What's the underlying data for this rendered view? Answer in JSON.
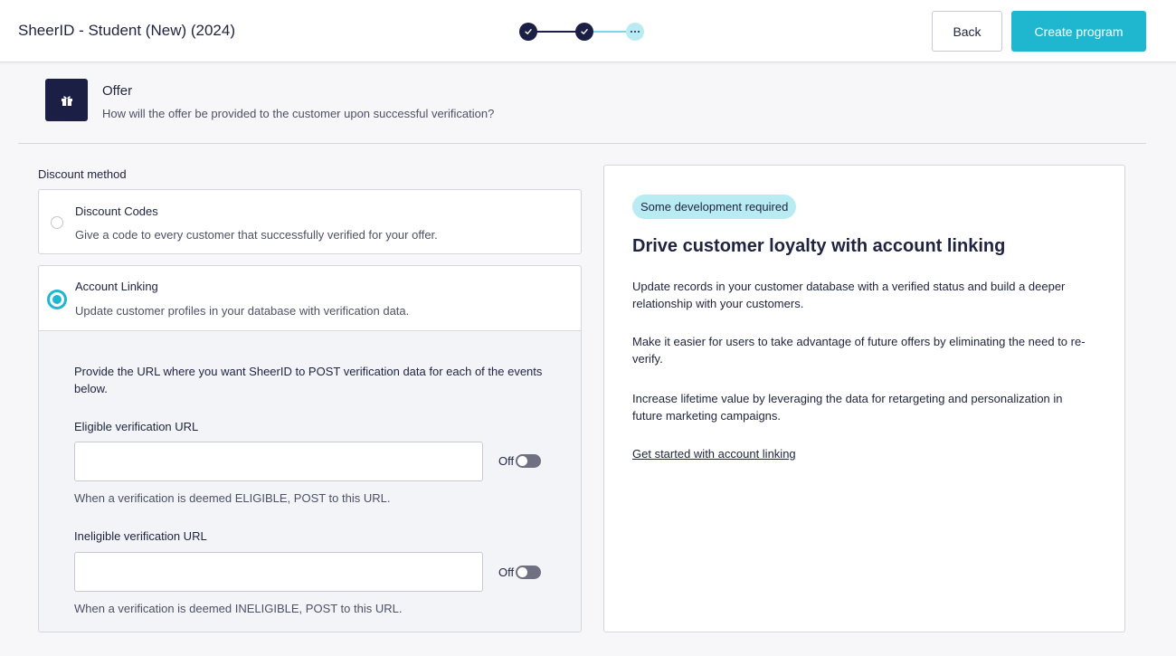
{
  "header": {
    "title": "SheerID - Student (New) (2024)",
    "steps": [
      {
        "state": "done",
        "icon": "check-icon"
      },
      {
        "state": "done",
        "icon": "check-icon"
      },
      {
        "state": "current",
        "icon": "ellipsis-icon"
      }
    ],
    "back_label": "Back",
    "create_label": "Create program",
    "colors": {
      "accent": "#1fb7cf",
      "dark": "#1c1f45",
      "pending": "#b9ecf2"
    }
  },
  "section": {
    "icon": "gift-icon",
    "title": "Offer",
    "description": "How will the offer be provided to the customer upon successful verification?"
  },
  "discount_method": {
    "label": "Discount method",
    "options": [
      {
        "title": "Discount Codes",
        "description": "Give a code to every customer that successfully verified for your offer.",
        "selected": false
      },
      {
        "title": "Account Linking",
        "description": "Update customer profiles in your database with verification data.",
        "selected": true
      }
    ]
  },
  "account_linking": {
    "intro": "Provide the URL where you want SheerID to POST verification data for each of the events below.",
    "eligible": {
      "label": "Eligible verification URL",
      "value": "",
      "toggle_label": "Off",
      "help": "When a verification is deemed ELIGIBLE, POST to this URL."
    },
    "ineligible": {
      "label": "Ineligible verification URL",
      "value": "",
      "toggle_label": "Off",
      "help": "When a verification is deemed INELIGIBLE, POST to this URL."
    }
  },
  "info": {
    "badge": "Some development required",
    "heading": "Drive customer loyalty with account linking",
    "paragraphs": [
      "Update records in your customer database with a verified status and build a deeper relationship with your customers.",
      "Make it easier for users to take advantage of future offers by eliminating the need to re-verify.",
      "Increase lifetime value by leveraging the data for retargeting and personalization in future marketing campaigns."
    ],
    "link": "Get started with account linking"
  }
}
